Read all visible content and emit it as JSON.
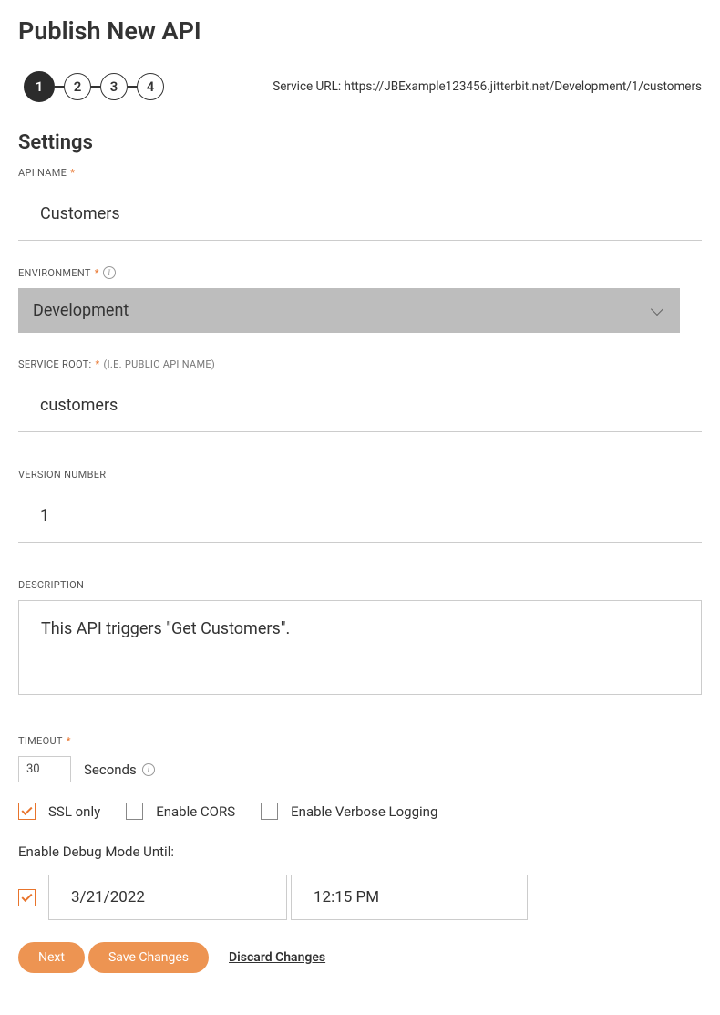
{
  "page_title": "Publish New API",
  "stepper": {
    "steps": [
      "1",
      "2",
      "3",
      "4"
    ],
    "active_index": 0
  },
  "service_url": {
    "label": "Service URL:",
    "value": "https://JBExample123456.jitterbit.net/Development/1/customers"
  },
  "section_title": "Settings",
  "fields": {
    "api_name": {
      "label": "API NAME",
      "required": true,
      "value": "Customers"
    },
    "environment": {
      "label": "ENVIRONMENT",
      "required": true,
      "value": "Development"
    },
    "service_root": {
      "label": "SERVICE ROOT:",
      "required": true,
      "hint": "(I.E. PUBLIC API NAME)",
      "value": "customers"
    },
    "version": {
      "label": "VERSION NUMBER",
      "value": "1"
    },
    "description": {
      "label": "DESCRIPTION",
      "value": "This API triggers \"Get Customers\"."
    },
    "timeout": {
      "label": "TIMEOUT",
      "required": true,
      "value": "30",
      "unit": "Seconds"
    }
  },
  "checkboxes": {
    "ssl_only": {
      "label": "SSL only",
      "checked": true
    },
    "enable_cors": {
      "label": "Enable CORS",
      "checked": false
    },
    "verbose_logging": {
      "label": "Enable Verbose Logging",
      "checked": false
    }
  },
  "debug_mode": {
    "label": "Enable Debug Mode Until:",
    "checked": true,
    "date": "3/21/2022",
    "time": "12:15 PM"
  },
  "buttons": {
    "next": "Next",
    "save": "Save Changes",
    "discard": "Discard Changes"
  }
}
